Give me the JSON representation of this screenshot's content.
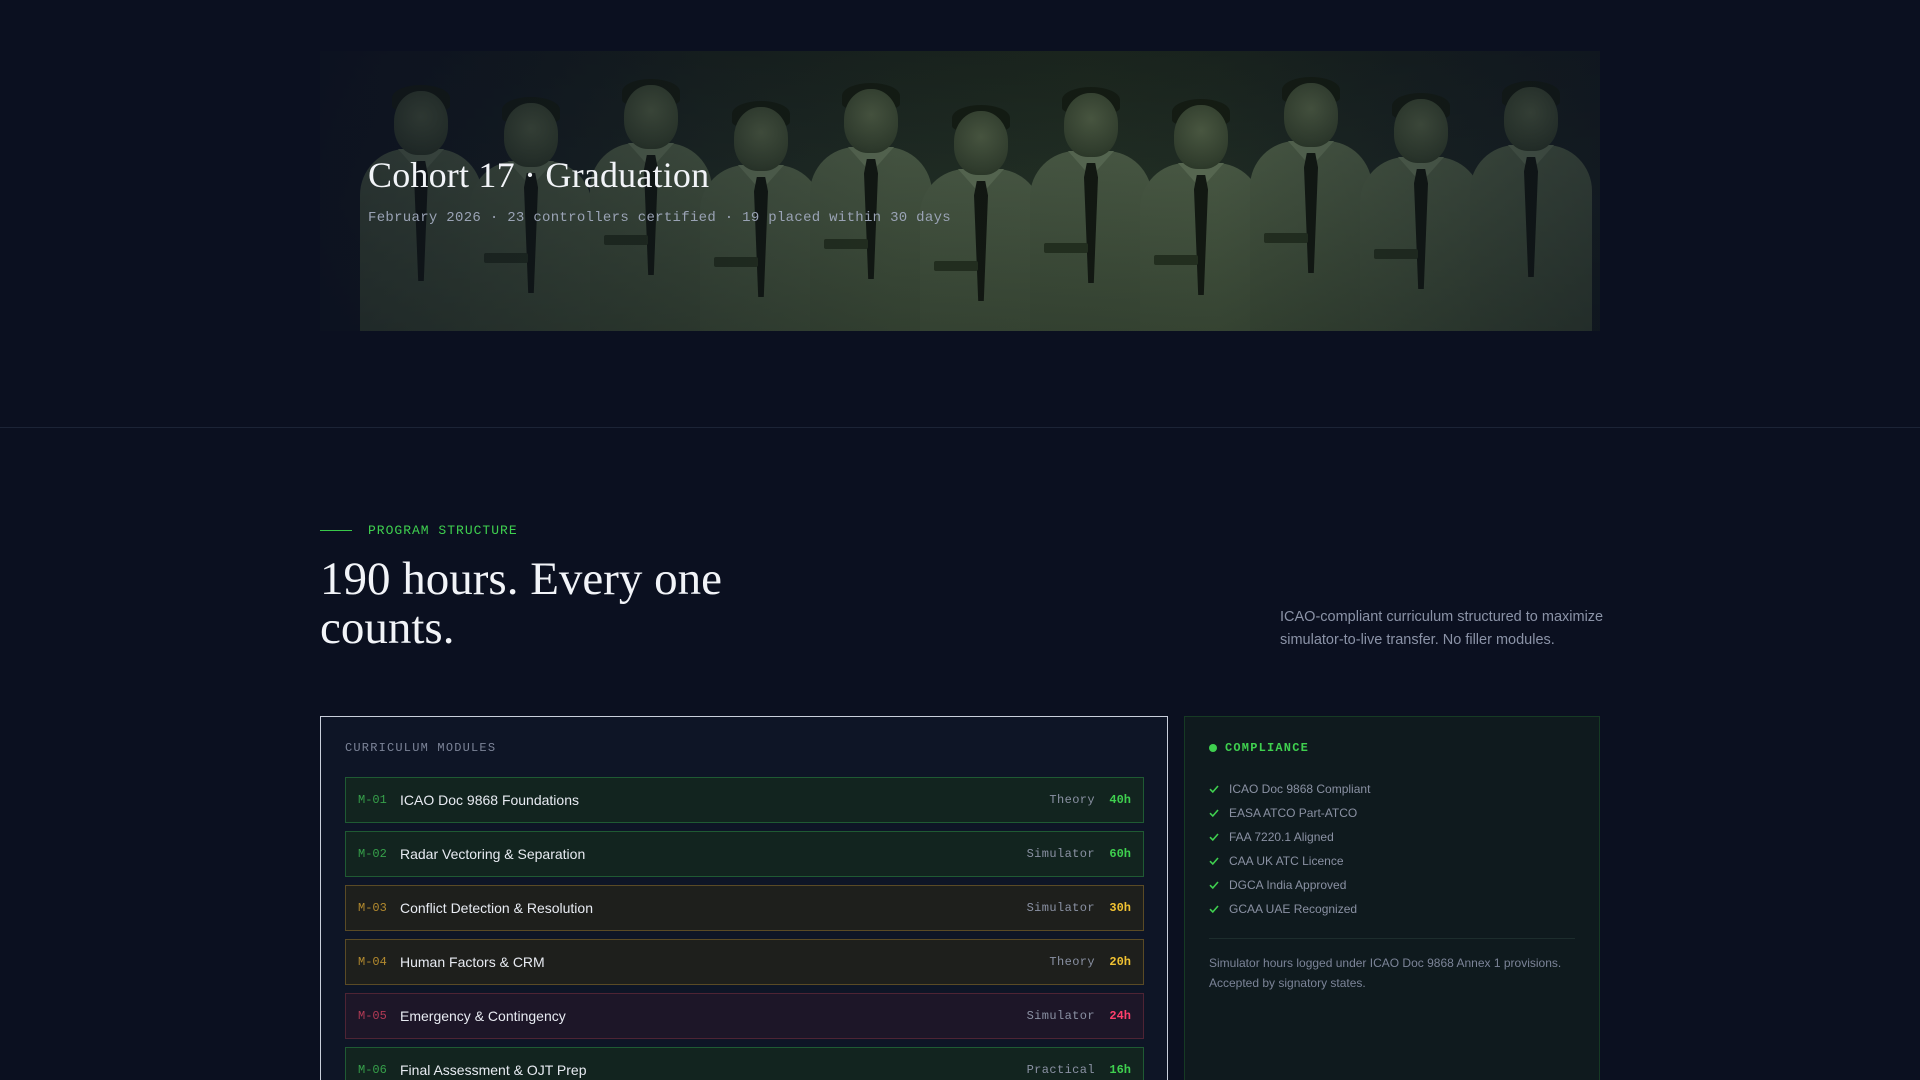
{
  "hero": {
    "title": "Cohort 17 · Graduation",
    "subtitle": "February 2026 · 23 controllers certified · 19 placed within 30 days"
  },
  "section": {
    "eyebrow": "PROGRAM STRUCTURE",
    "title": "190 hours. Every one counts.",
    "description": "ICAO-compliant curriculum structured to maximize simulator-to-live transfer. No filler modules."
  },
  "curriculum": {
    "label": "CURRICULUM MODULES",
    "modules": [
      {
        "code": "M-01",
        "title": "ICAO Doc 9868 Foundations",
        "type": "Theory",
        "hours": "40h",
        "tone": "green"
      },
      {
        "code": "M-02",
        "title": "Radar Vectoring & Separation",
        "type": "Simulator",
        "hours": "60h",
        "tone": "green"
      },
      {
        "code": "M-03",
        "title": "Conflict Detection & Resolution",
        "type": "Simulator",
        "hours": "30h",
        "tone": "amber"
      },
      {
        "code": "M-04",
        "title": "Human Factors & CRM",
        "type": "Theory",
        "hours": "20h",
        "tone": "amber"
      },
      {
        "code": "M-05",
        "title": "Emergency & Contingency",
        "type": "Simulator",
        "hours": "24h",
        "tone": "red"
      },
      {
        "code": "M-06",
        "title": "Final Assessment & OJT Prep",
        "type": "Practical",
        "hours": "16h",
        "tone": "green"
      }
    ]
  },
  "compliance": {
    "title": "COMPLIANCE",
    "items": [
      "ICAO Doc 9868 Compliant",
      "EASA ATCO Part-ATCO",
      "FAA 7220.1 Aligned",
      "CAA UK ATC Licence",
      "DGCA India Approved",
      "GCAA UAE Recognized"
    ],
    "note": "Simulator hours logged under ICAO Doc 9868 Annex 1 provisions. Accepted by signatory states."
  },
  "colors": {
    "background": "#0b1020",
    "accent_green": "#3fd04f",
    "accent_amber": "#f1c232",
    "accent_red": "#ff3f6c"
  },
  "icons": {
    "compliance_bullet": "check-icon",
    "compliance_status": "status-dot-icon"
  }
}
